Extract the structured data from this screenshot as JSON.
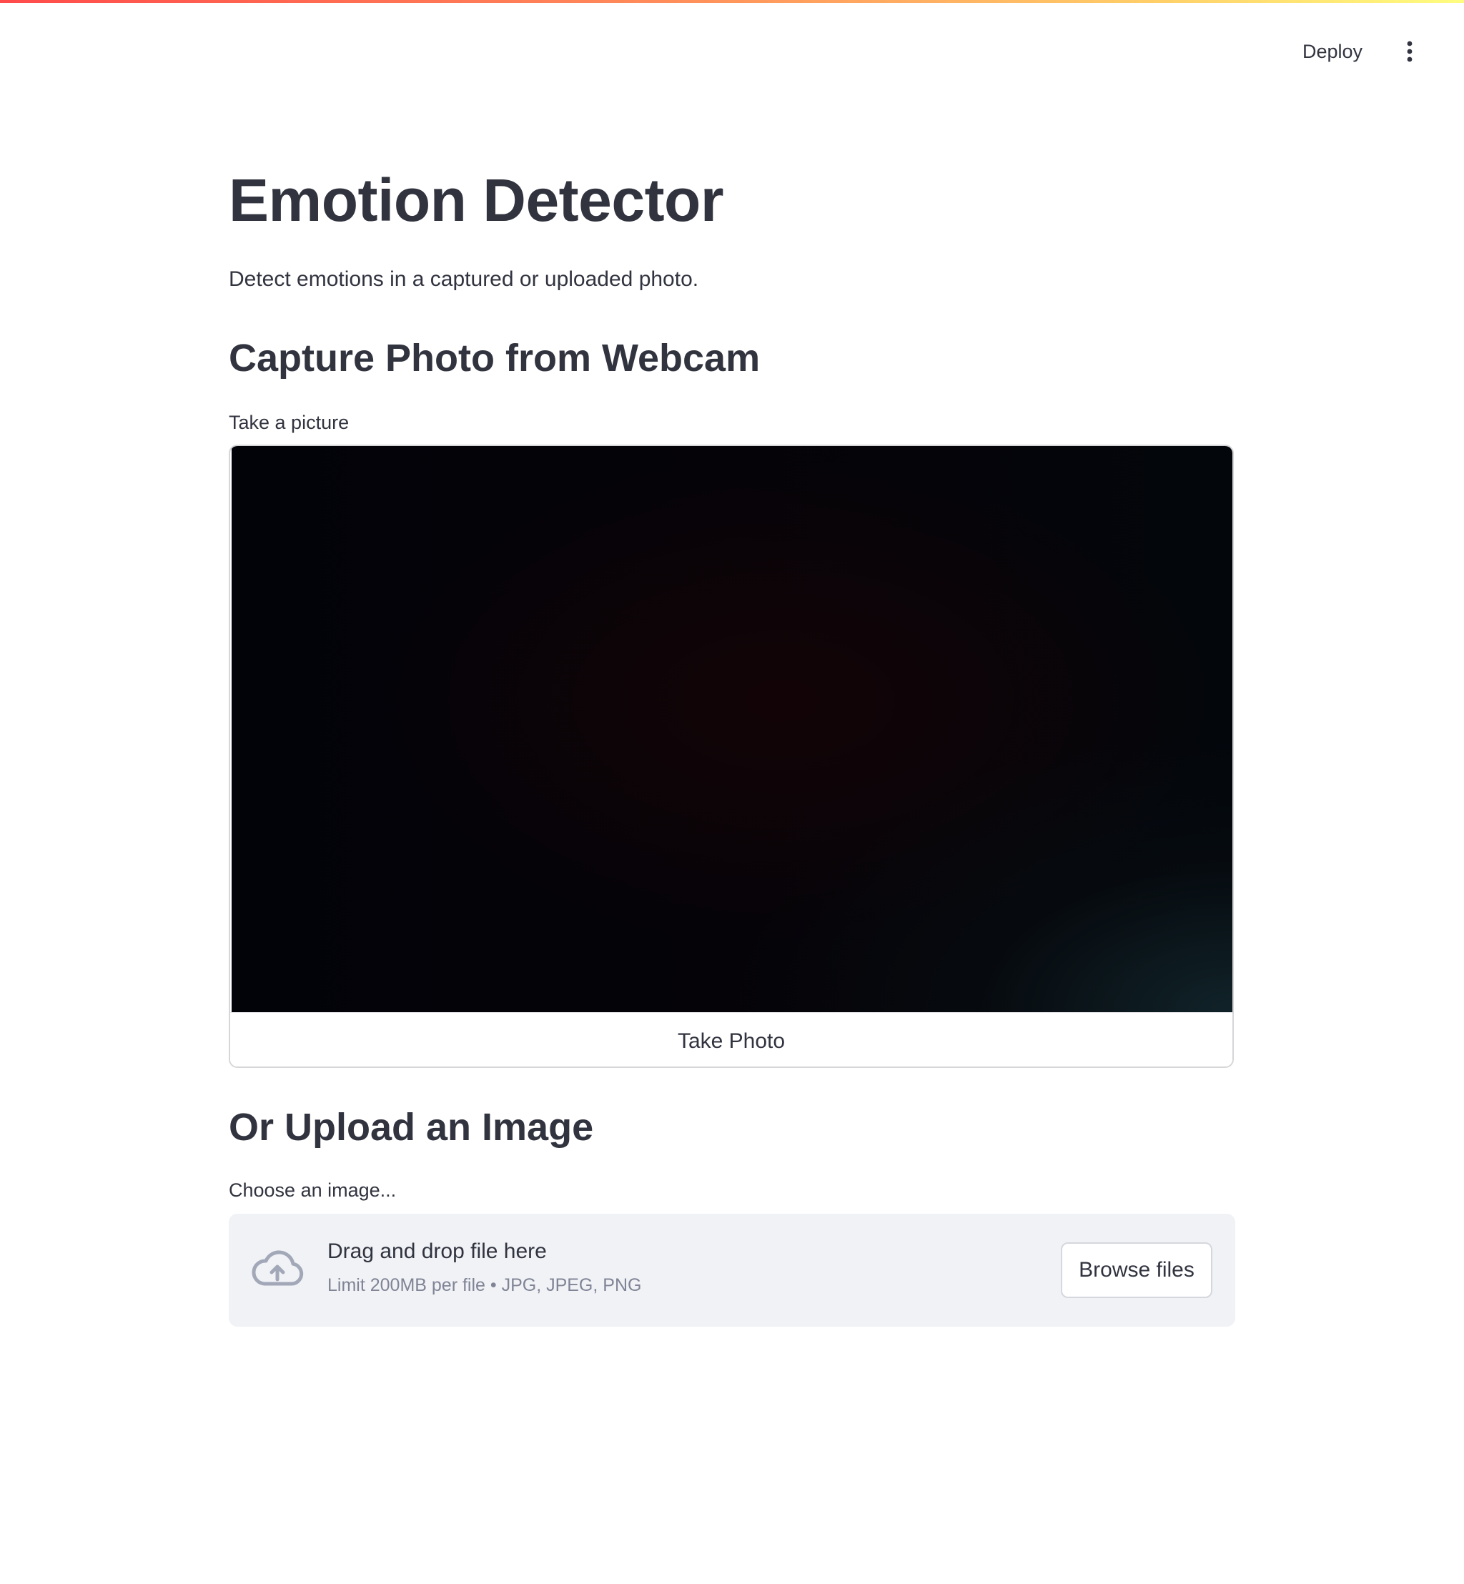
{
  "header": {
    "deploy_label": "Deploy",
    "menu_icon": "vertical-ellipsis-icon"
  },
  "colors": {
    "text": "#31333f",
    "muted": "#808495",
    "dropzone_bg": "#f0f2f6",
    "accent": "#ff4b4b"
  },
  "main": {
    "title": "Emotion Detector",
    "subtitle": "Detect emotions in a captured or uploaded photo.",
    "capture_heading": "Capture Photo from Webcam",
    "camera_label": "Take a picture",
    "take_photo_label": "Take Photo",
    "upload_heading": "Or Upload an Image",
    "uploader_label": "Choose an image...",
    "dropzone": {
      "icon": "cloud-upload-icon",
      "main_text": "Drag and drop file here",
      "limit_text": "Limit 200MB per file • JPG, JPEG, PNG",
      "browse_label": "Browse files"
    }
  }
}
